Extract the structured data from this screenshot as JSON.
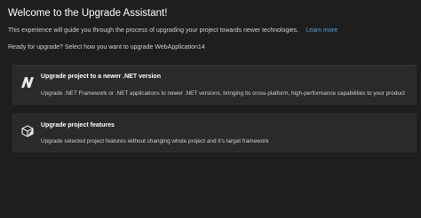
{
  "header": {
    "title": "Welcome to the Upgrade Assistant!",
    "intro_text": "This experience will guide you through the process of upgrading your project towards newer technologies.",
    "learn_more": "Learn more",
    "ready_text": "Ready for upgrade? Select how you want to upgrade WebApplication14"
  },
  "options": [
    {
      "title": "Upgrade project to a newer .NET version",
      "description": "Upgrade .NET Framework or .NET applications to newer .NET versions, bringing its cross-platform, high-performance capabilities to your product",
      "icon": "dotnet-icon"
    },
    {
      "title": "Upgrade project features",
      "description": "Upgrade selected project features without changing whole project and it's target framework",
      "icon": "package-icon"
    }
  ],
  "colors": {
    "background": "#1e1e1e",
    "card": "#2a2a2b",
    "link": "#4aa3e8"
  }
}
